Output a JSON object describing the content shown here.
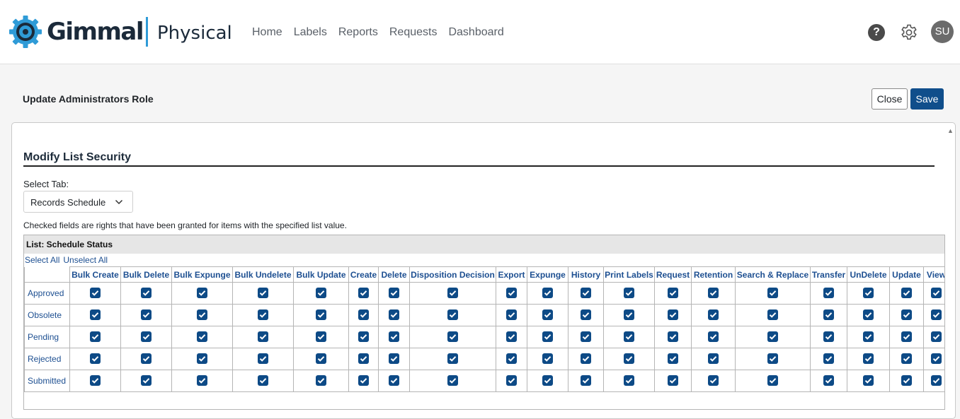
{
  "header": {
    "brand": "Gimmal",
    "product": "Physical",
    "nav": [
      "Home",
      "Labels",
      "Reports",
      "Requests",
      "Dashboard"
    ],
    "help_symbol": "?",
    "avatar_initials": "SU",
    "icons": {
      "logo": "gear-logo-icon",
      "help": "help-icon",
      "settings": "gear-icon"
    },
    "colors": {
      "brand_text": "#1b2a3a",
      "logo_blue": "#2f9bd7",
      "separator": "#2f9bd7"
    }
  },
  "page": {
    "title": "Update Administrators Role",
    "close_label": "Close",
    "save_label": "Save",
    "accent_color": "#104e8b"
  },
  "section": {
    "title": "Modify List Security",
    "select_tab_label": "Select Tab:",
    "select_tab_value": "Records Schedule",
    "info_text": "Checked fields are rights that have been granted for items with the specified list value."
  },
  "list": {
    "title": "List: Schedule Status",
    "select_all": "Select All",
    "unselect_all": "Unselect All",
    "columns": [
      "Bulk Create",
      "Bulk Delete",
      "Bulk Expunge",
      "Bulk Undelete",
      "Bulk Update",
      "Create",
      "Delete",
      "Disposition Decision",
      "Export",
      "Expunge",
      "History",
      "Print Labels",
      "Request",
      "Retention",
      "Search & Replace",
      "Transfer",
      "UnDelete",
      "Update",
      "View"
    ],
    "rows": [
      {
        "label": "Approved",
        "checked": [
          true,
          true,
          true,
          true,
          true,
          true,
          true,
          true,
          true,
          true,
          true,
          true,
          true,
          true,
          true,
          true,
          true,
          true,
          true
        ]
      },
      {
        "label": "Obsolete",
        "checked": [
          true,
          true,
          true,
          true,
          true,
          true,
          true,
          true,
          true,
          true,
          true,
          true,
          true,
          true,
          true,
          true,
          true,
          true,
          true
        ]
      },
      {
        "label": "Pending",
        "checked": [
          true,
          true,
          true,
          true,
          true,
          true,
          true,
          true,
          true,
          true,
          true,
          true,
          true,
          true,
          true,
          true,
          true,
          true,
          true
        ]
      },
      {
        "label": "Rejected",
        "checked": [
          true,
          true,
          true,
          true,
          true,
          true,
          true,
          true,
          true,
          true,
          true,
          true,
          true,
          true,
          true,
          true,
          true,
          true,
          true
        ]
      },
      {
        "label": "Submitted",
        "checked": [
          true,
          true,
          true,
          true,
          true,
          true,
          true,
          true,
          true,
          true,
          true,
          true,
          true,
          true,
          true,
          true,
          true,
          true,
          true
        ]
      }
    ],
    "colors": {
      "checkbox": "#0d4a86",
      "link": "#1d4f91",
      "header_bg": "#e6e6e6"
    }
  }
}
